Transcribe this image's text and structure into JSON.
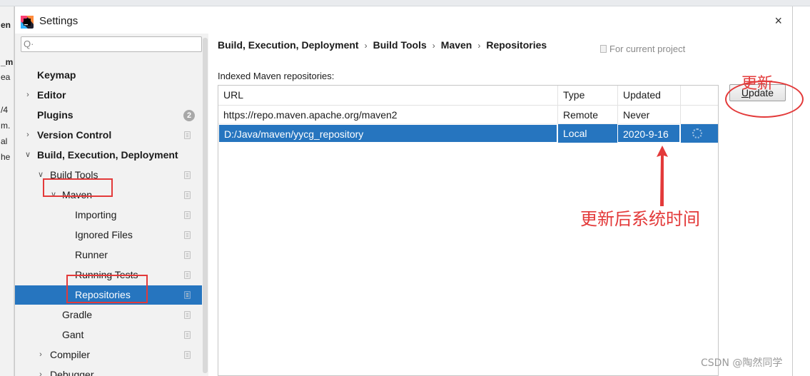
{
  "window": {
    "title": "Settings",
    "close_glyph": "×"
  },
  "background_fragments": [
    "en",
    "_m",
    "ea",
    "/4",
    "m.",
    "al",
    "he"
  ],
  "search": {
    "placeholder": "",
    "value": "",
    "icon_glyph": "Q·"
  },
  "tree": {
    "items": [
      {
        "label": "Keymap"
      },
      {
        "label": "Editor"
      },
      {
        "label": "Plugins",
        "badge": "2"
      },
      {
        "label": "Version Control"
      },
      {
        "label": "Build, Execution, Deployment"
      },
      {
        "label": "Build Tools"
      },
      {
        "label": "Maven"
      },
      {
        "label": "Importing"
      },
      {
        "label": "Ignored Files"
      },
      {
        "label": "Runner"
      },
      {
        "label": "Running Tests"
      },
      {
        "label": "Repositories"
      },
      {
        "label": "Gradle"
      },
      {
        "label": "Gant"
      },
      {
        "label": "Compiler"
      },
      {
        "label": "Debugger"
      }
    ],
    "arrow_collapsed": "›",
    "arrow_expanded": "∨"
  },
  "breadcrumb": {
    "items": [
      "Build, Execution, Deployment",
      "Build Tools",
      "Maven",
      "Repositories"
    ],
    "separator": "›"
  },
  "for_current_project": "For current project",
  "section_label": "Indexed Maven repositories:",
  "table": {
    "headers": [
      "URL",
      "Type",
      "Updated"
    ],
    "rows": [
      {
        "url": "https://repo.maven.apache.org/maven2",
        "type": "Remote",
        "updated": "Never"
      },
      {
        "url": "D:/Java/maven/yycg_repository",
        "type": "Local",
        "updated": "2020-9-16"
      }
    ]
  },
  "update_button": {
    "mnemonic": "U",
    "rest": "pdate"
  },
  "annotations": {
    "top": "更新",
    "middle": "更新后系统时间"
  },
  "watermark": "CSDN @陶然同学",
  "colors": {
    "selection": "#2675bf",
    "annotation_red": "#e33a3a"
  }
}
